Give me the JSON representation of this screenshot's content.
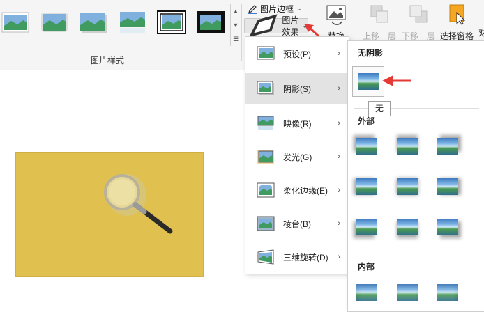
{
  "ribbon": {
    "group_label": "图片样式",
    "border_label": "图片边框",
    "effect_label": "图片效果",
    "replace_label": "替换",
    "bring_forward_label": "上移一层",
    "send_backward_label": "下移一层",
    "selection_pane_label": "选择窗格",
    "cut_char": "对"
  },
  "effects_menu": {
    "items": [
      {
        "label": "预设(P)"
      },
      {
        "label": "阴影(S)"
      },
      {
        "label": "映像(R)"
      },
      {
        "label": "发光(G)"
      },
      {
        "label": "柔化边缘(E)"
      },
      {
        "label": "棱台(B)"
      },
      {
        "label": "三维旋转(D)"
      }
    ],
    "active_index": 1
  },
  "shadow_submenu": {
    "no_shadow_heading": "无阴影",
    "outer_heading": "外部",
    "inner_heading": "内部",
    "tooltip": "无"
  },
  "colors": {
    "photo_bg": "#e0c04e",
    "annotation_red": "#e53935",
    "accent_orange": "#f5a623"
  }
}
